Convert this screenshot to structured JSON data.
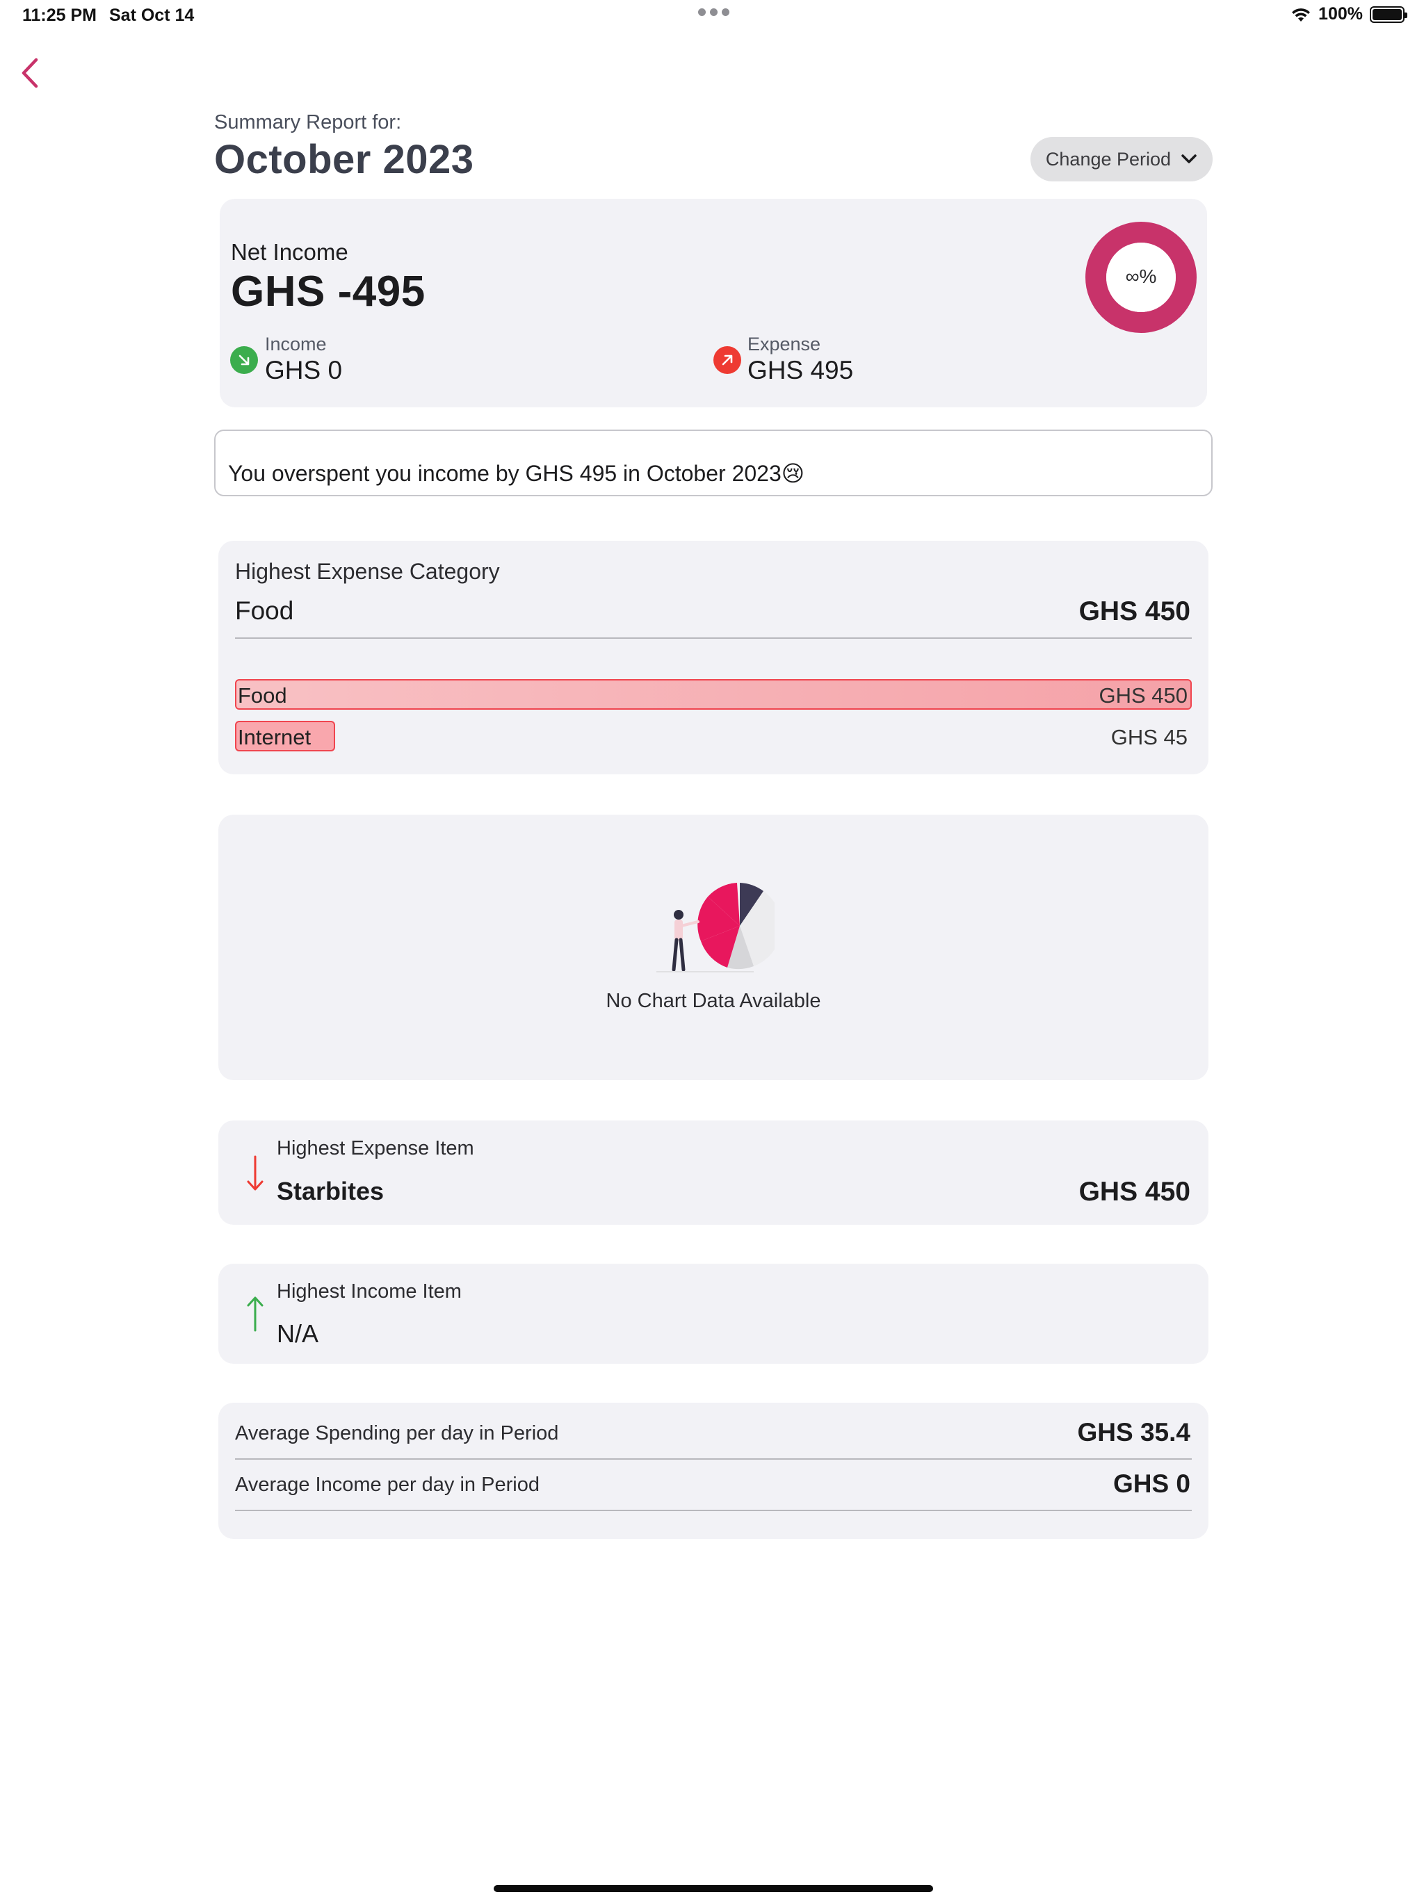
{
  "status_bar": {
    "time": "11:25 PM",
    "date": "Sat Oct 14",
    "battery": "100%"
  },
  "header": {
    "subtitle": "Summary Report for:",
    "period": "October 2023",
    "change_period_label": "Change Period"
  },
  "net_income": {
    "label": "Net Income",
    "value": "GHS -495",
    "donut_text": "∞%",
    "income_label": "Income",
    "income_value": "GHS 0",
    "expense_label": "Expense",
    "expense_value": "GHS 495"
  },
  "message": "You overspent you income by GHS 495 in October 2023😢",
  "highest_category": {
    "title": "Highest Expense Category",
    "name": "Food",
    "amount": "GHS 450",
    "bars": [
      {
        "label": "Food",
        "amount": "GHS 450",
        "value": 450
      },
      {
        "label": "Internet",
        "amount": "GHS 45",
        "value": 45
      }
    ]
  },
  "chart": {
    "empty_text": "No Chart Data Available"
  },
  "highest_expense_item": {
    "label": "Highest Expense Item",
    "name": "Starbites",
    "amount": "GHS 450"
  },
  "highest_income_item": {
    "label": "Highest Income Item",
    "name": "N/A"
  },
  "averages": {
    "spending_label": "Average Spending per day in Period",
    "spending_value": "GHS 35.4",
    "income_label": "Average Income per day in Period",
    "income_value": "GHS 0"
  },
  "colors": {
    "accent": "#c8336a",
    "income_green": "#3bad4d",
    "expense_red": "#ee3a32",
    "card_bg": "#f2f2f6"
  }
}
